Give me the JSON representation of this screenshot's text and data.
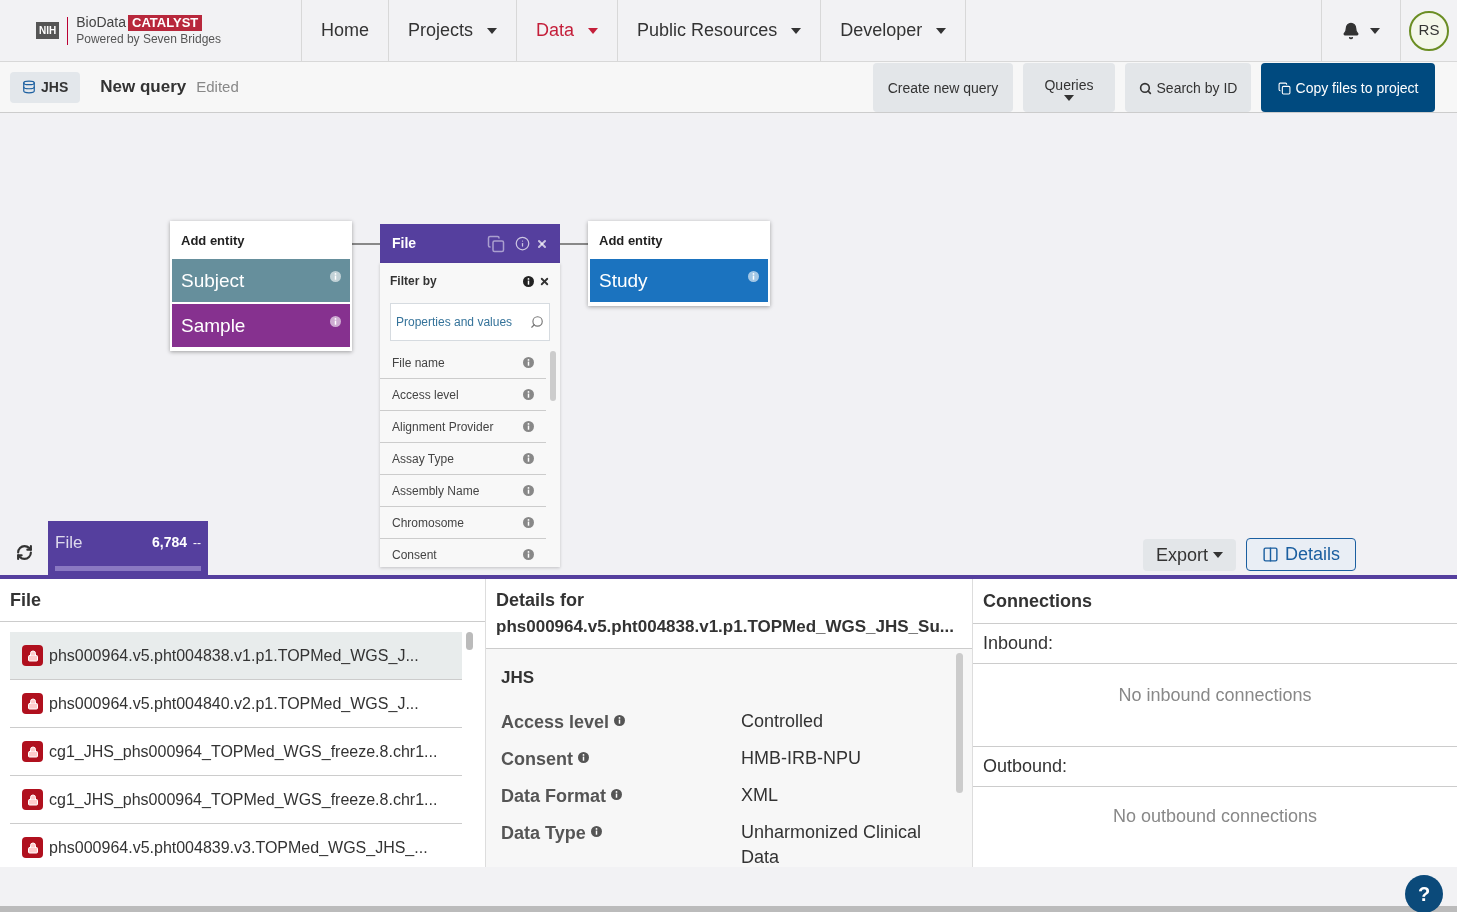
{
  "logo": {
    "agency": "NIH",
    "brand": "BioData",
    "product": "CATALYST",
    "tagline": "Powered by Seven Bridges"
  },
  "nav": [
    {
      "label": "Home",
      "selected": false,
      "dropdown": false
    },
    {
      "label": "Projects",
      "selected": false,
      "dropdown": true
    },
    {
      "label": "Data",
      "selected": true,
      "dropdown": true
    },
    {
      "label": "Public Resources",
      "selected": false,
      "dropdown": true
    },
    {
      "label": "Developer",
      "selected": false,
      "dropdown": true
    }
  ],
  "user": {
    "initials": "RS"
  },
  "toolbar": {
    "dataset": "JHS",
    "query_title": "New query",
    "status": "Edited",
    "buttons": [
      {
        "label": "Create new query",
        "kind": "plain"
      },
      {
        "label": "Queries",
        "kind": "dropdown"
      },
      {
        "label": "Search by ID",
        "kind": "search"
      },
      {
        "label": "Copy files to project",
        "kind": "primary"
      }
    ]
  },
  "canvas": {
    "left_node": {
      "title": "Add entity",
      "entities": [
        {
          "label": "Subject",
          "color": "#668f9c"
        },
        {
          "label": "Sample",
          "color": "#86318f"
        }
      ]
    },
    "center_node": {
      "title": "File",
      "filter_title": "Filter by",
      "search_placeholder": "Properties and values",
      "properties": [
        "File name",
        "Access level",
        "Alignment Provider",
        "Assay Type",
        "Assembly Name",
        "Chromosome",
        "Consent"
      ]
    },
    "right_node": {
      "title": "Add entity",
      "entities": [
        {
          "label": "Study",
          "color": "#1b73bf"
        }
      ]
    }
  },
  "result_tab": {
    "entity": "File",
    "count": "6,784",
    "extra": "--",
    "level": 1
  },
  "actions": {
    "export": "Export",
    "details": "Details"
  },
  "file_list": {
    "title": "File",
    "files": [
      {
        "name": "phs000964.v5.pht004838.v1.p1.TOPMed_WGS_J...",
        "selected": true
      },
      {
        "name": "phs000964.v5.pht004840.v2.p1.TOPMed_WGS_J...",
        "selected": false
      },
      {
        "name": "cg1_JHS_phs000964_TOPMed_WGS_freeze.8.chr1...",
        "selected": false
      },
      {
        "name": "cg1_JHS_phs000964_TOPMed_WGS_freeze.8.chr1...",
        "selected": false
      },
      {
        "name": "phs000964.v5.pht004839.v3.TOPMed_WGS_JHS_...",
        "selected": false
      }
    ]
  },
  "details": {
    "title": "Details for",
    "file": "phs000964.v5.pht004838.v1.p1.TOPMed_WGS_JHS_Su...",
    "section": "JHS",
    "fields": [
      {
        "label": "Access level",
        "value": "Controlled"
      },
      {
        "label": "Consent",
        "value": "HMB-IRB-NPU"
      },
      {
        "label": "Data Format",
        "value": "XML"
      },
      {
        "label": "Data Type",
        "value": "Unharmonized Clinical Data"
      }
    ]
  },
  "connections": {
    "title": "Connections",
    "inbound_label": "Inbound:",
    "inbound_empty": "No inbound connections",
    "outbound_label": "Outbound:",
    "outbound_empty": "No outbound connections"
  },
  "help": "?"
}
